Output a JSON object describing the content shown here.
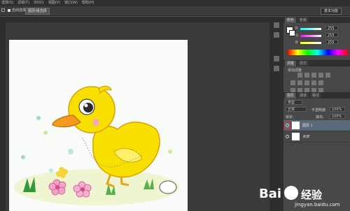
{
  "menu": [
    "选择(S)",
    "滤镜(T)",
    "3D(D)",
    "视图(V)",
    "窗口(W)",
    "帮助(H)"
  ],
  "options": {
    "label": "自动选择:",
    "group_button": "图层/组选择",
    "workspace": "基本功能"
  },
  "color_panel": {
    "tabs": [
      "颜色",
      "色板"
    ],
    "channels": [
      {
        "name": "R",
        "value": "255"
      },
      {
        "name": "G",
        "value": "255"
      },
      {
        "name": "B",
        "value": "255"
      }
    ]
  },
  "adjust_panel": {
    "tabs": [
      "调整",
      "样式"
    ],
    "label": "添加调整"
  },
  "layers_panel": {
    "tabs": [
      "图层",
      "通道",
      "路径"
    ],
    "kind_filter": "类型",
    "blend_mode": "正常",
    "opacity_label": "不透明度:",
    "opacity": "100%",
    "lock_label": "锁定:",
    "fill_label": "填充:",
    "fill": "100%",
    "layers": [
      {
        "name": "图层 1",
        "selected": true
      },
      {
        "name": "背景",
        "selected": false
      }
    ]
  },
  "watermark": {
    "brand_a": "Bai",
    "brand_b": "经验",
    "url": "jingyan.baidu.com"
  },
  "colors": {
    "accent_red": "#e02020",
    "duck_yellow": "#f7e000",
    "beak_orange": "#f39a1e"
  }
}
